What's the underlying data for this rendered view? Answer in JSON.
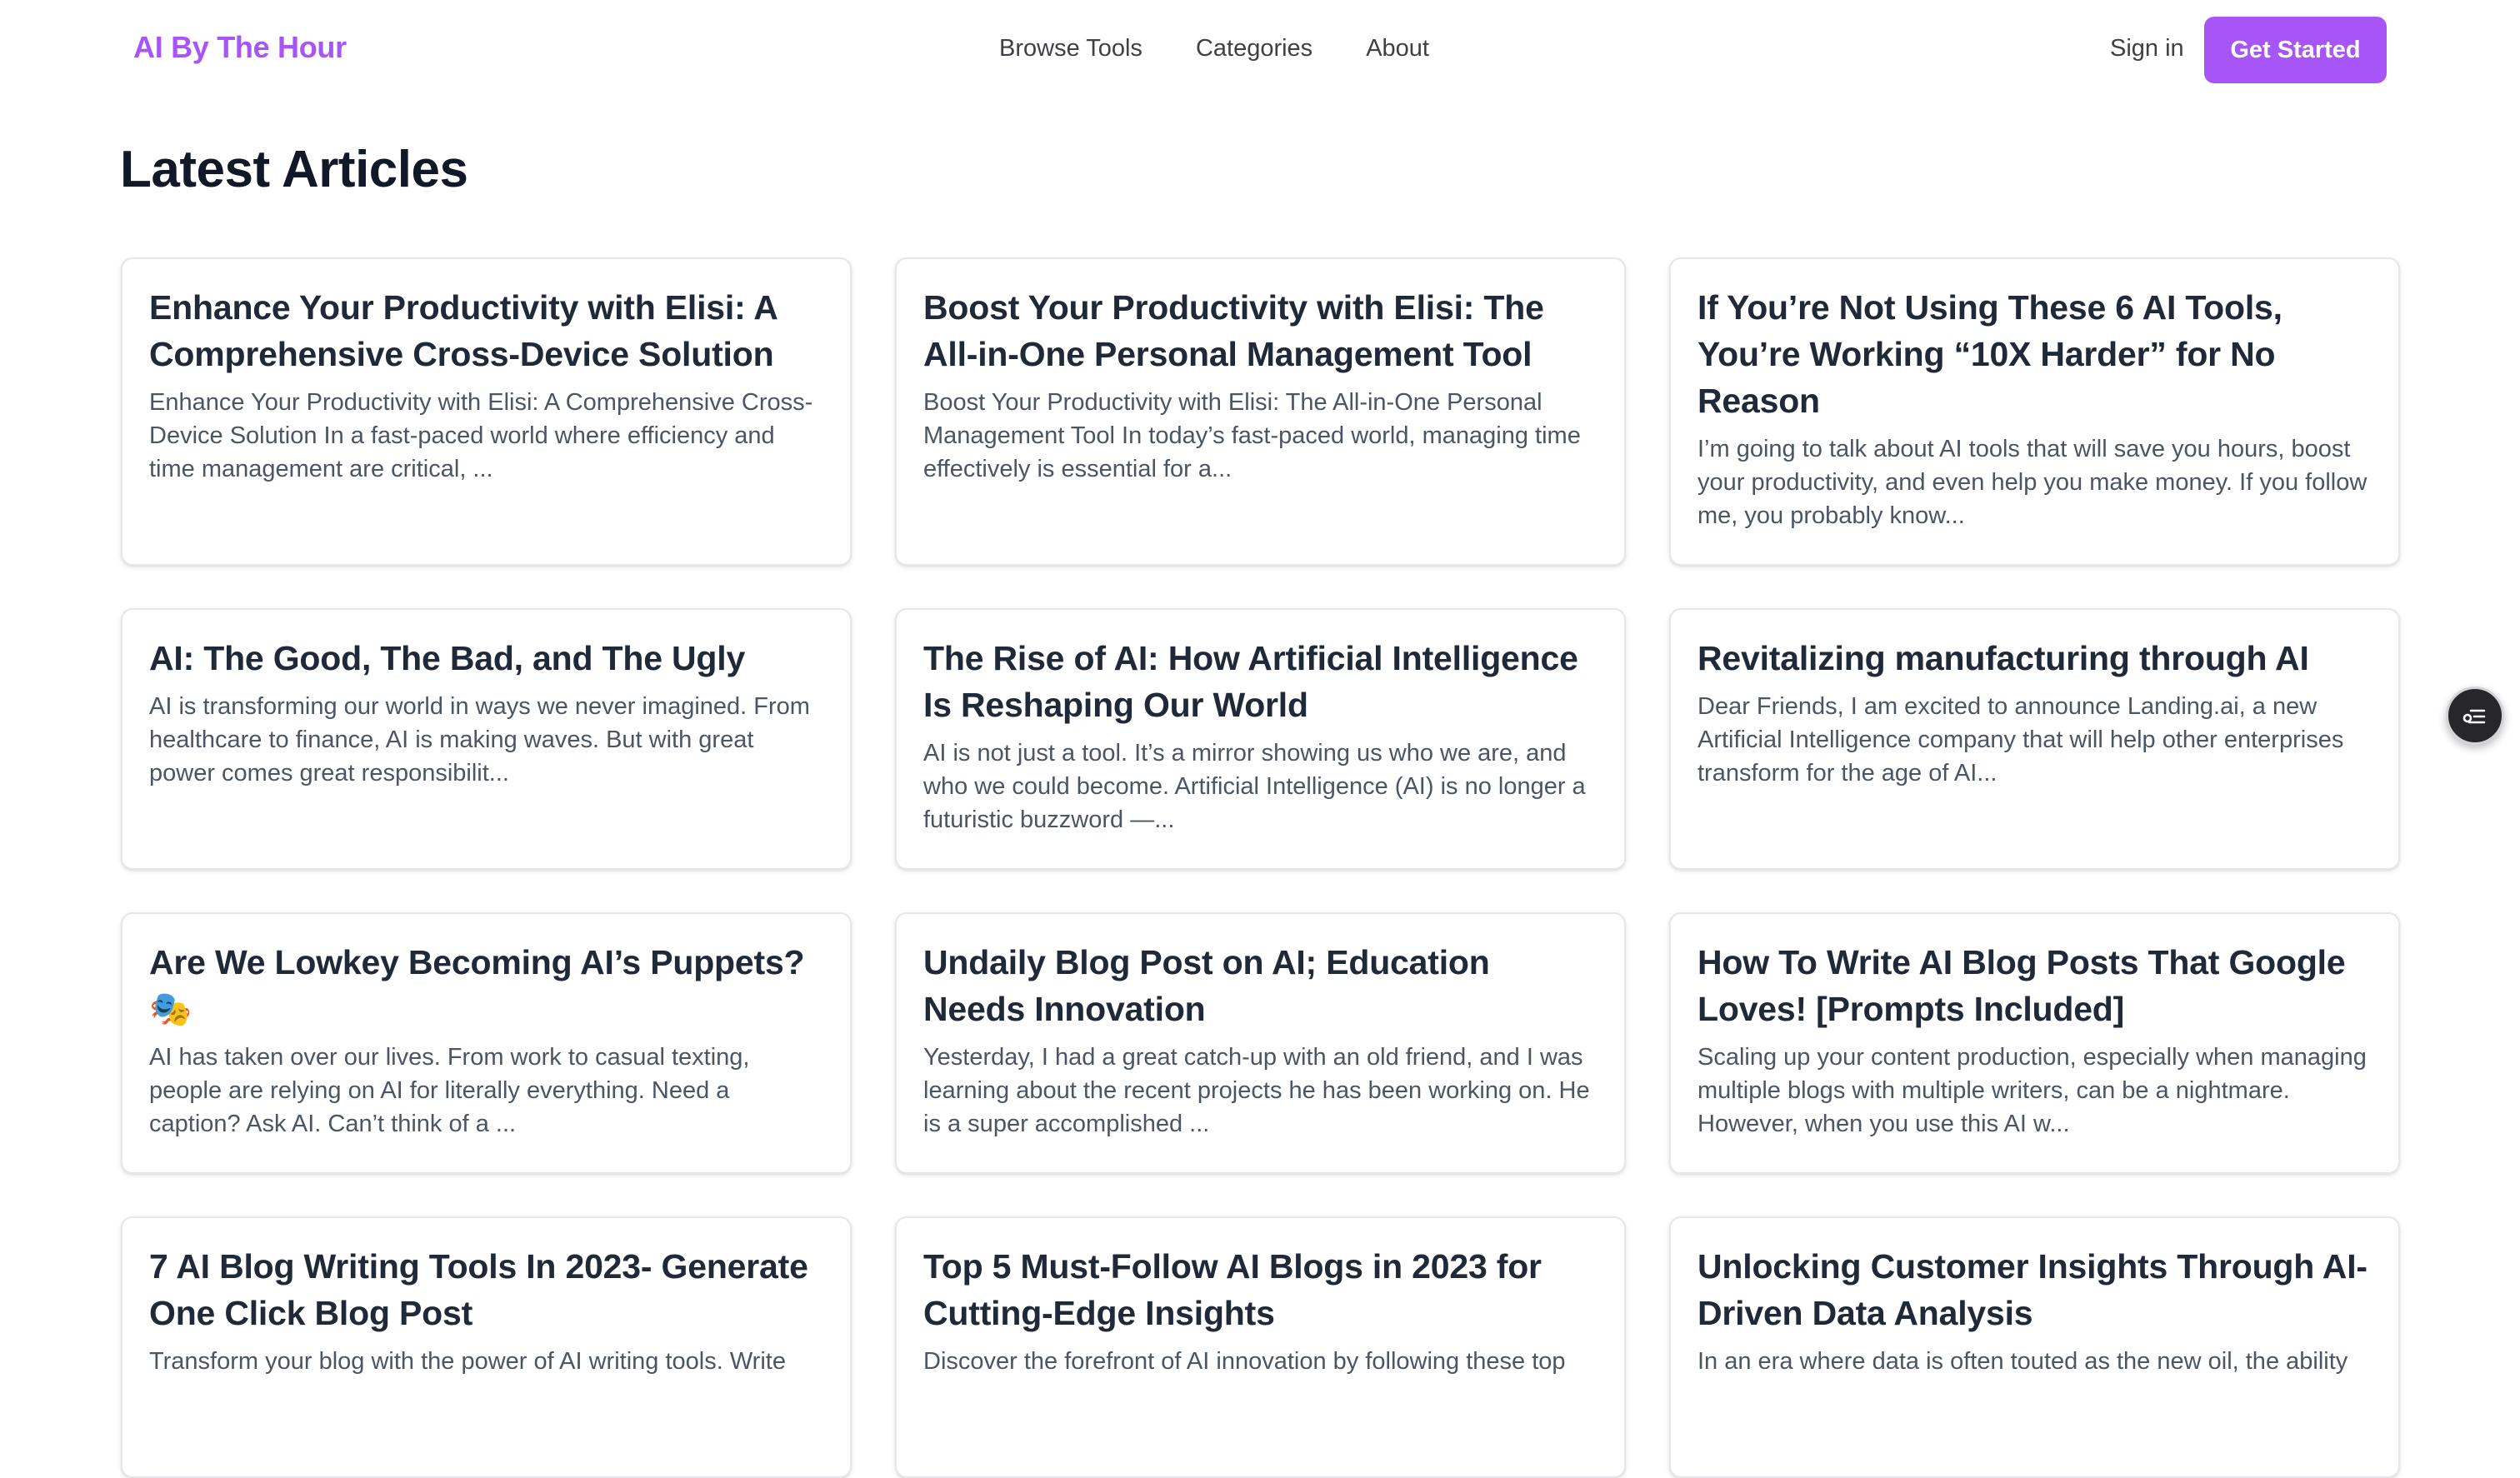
{
  "header": {
    "brand": "AI By The Hour",
    "nav": [
      "Browse Tools",
      "Categories",
      "About"
    ],
    "sign_in": "Sign in",
    "get_started": "Get Started"
  },
  "page_title": "Latest Articles",
  "articles": [
    {
      "title": "Enhance Your Productivity with Elisi: A Comprehensive Cross-Device Solution",
      "excerpt": "Enhance Your Productivity with Elisi: A Comprehensive Cross-Device Solution In a fast-paced world where efficiency and time management are critical, ..."
    },
    {
      "title": "Boost Your Productivity with Elisi: The All-in-One Personal Management Tool",
      "excerpt": "Boost Your Productivity with Elisi: The All-in-One Personal Management Tool In today’s fast-paced world, managing time effectively is essential for a..."
    },
    {
      "title": "If You’re Not Using These 6 AI Tools, You’re Working “10X Harder” for No Reason",
      "excerpt": "I’m going to talk about AI tools that will save you hours, boost your productivity, and even help you make money. If you follow me, you probably know..."
    },
    {
      "title": "AI: The Good, The Bad, and The Ugly",
      "excerpt": "AI is transforming our world in ways we never imagined. From healthcare to finance, AI is making waves. But with great power comes great responsibilit..."
    },
    {
      "title": "The Rise of AI: How Artificial Intelligence Is Reshaping Our World",
      "excerpt": "AI is not just a tool. It’s a mirror showing us who we are, and who we could become. Artificial Intelligence (AI) is no longer a futuristic buzzword —..."
    },
    {
      "title": "Revitalizing manufacturing through AI",
      "excerpt": "Dear Friends, I am excited to announce Landing.ai, a new Artificial Intelligence company that will help other enterprises transform for the age of AI..."
    },
    {
      "title": "Are We Lowkey Becoming AI’s Puppets? 🎭",
      "excerpt": "AI has taken over our lives. From work to casual texting, people are relying on AI for literally everything. Need a caption? Ask AI. Can’t think of a ..."
    },
    {
      "title": "Undaily Blog Post on AI; Education Needs Innovation",
      "excerpt": "Yesterday, I had a great catch-up with an old friend, and I was learning about the recent projects he has been working on. He is a super accomplished ..."
    },
    {
      "title": "How To Write AI Blog Posts That Google Loves! [Prompts Included]",
      "excerpt": "Scaling up your content production, especially when managing multiple blogs with multiple writers, can be a nightmare. However, when you use this AI w..."
    },
    {
      "title": "7 AI Blog Writing Tools In 2023- Generate One Click Blog Post",
      "excerpt": "Transform your blog with the power of AI writing tools. Write"
    },
    {
      "title": "Top 5 Must-Follow AI Blogs in 2023 for Cutting-Edge Insights",
      "excerpt": "Discover the forefront of AI innovation by following these top"
    },
    {
      "title": "Unlocking Customer Insights Through AI-Driven Data Analysis",
      "excerpt": "In an era where data is often touted as the new oil, the ability"
    }
  ],
  "floating_button_icon": "list-filter-icon",
  "colors": {
    "accent": "#a855f7",
    "text": "#1f2937",
    "muted": "#4b5563",
    "border": "#e5e7eb",
    "fab": "#27272a"
  }
}
